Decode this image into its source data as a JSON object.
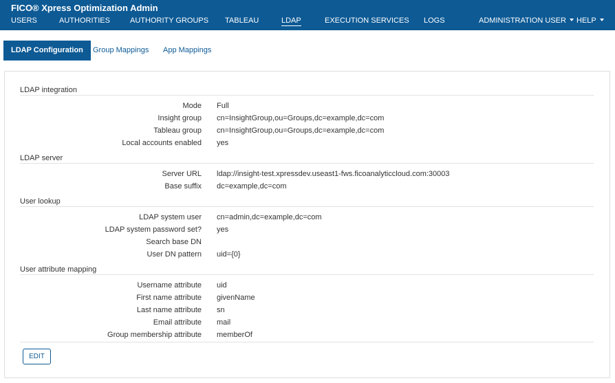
{
  "header": {
    "app_title": "FICO® Xpress Optimization Admin",
    "nav": [
      {
        "label": "USERS"
      },
      {
        "label": "AUTHORITIES"
      },
      {
        "label": "AUTHORITY GROUPS"
      },
      {
        "label": "TABLEAU"
      },
      {
        "label": "LDAP",
        "active": true
      },
      {
        "label": "EXECUTION SERVICES"
      },
      {
        "label": "LOGS"
      }
    ],
    "user_menu": "ADMINISTRATION USER",
    "help_menu": "HELP"
  },
  "subtabs": [
    {
      "label": "LDAP Configuration",
      "active": true
    },
    {
      "label": "Group Mappings"
    },
    {
      "label": "App Mappings"
    }
  ],
  "sections": [
    {
      "title": "LDAP integration",
      "rows": [
        {
          "label": "Mode",
          "value": "Full"
        },
        {
          "label": "Insight group",
          "value": "cn=InsightGroup,ou=Groups,dc=example,dc=com"
        },
        {
          "label": "Tableau group",
          "value": "cn=InsightGroup,ou=Groups,dc=example,dc=com"
        },
        {
          "label": "Local accounts enabled",
          "value": "yes"
        }
      ]
    },
    {
      "title": "LDAP server",
      "rows": [
        {
          "label": "Server URL",
          "value": "ldap://insight-test.xpressdev.useast1-fws.ficoanalyticcloud.com:30003"
        },
        {
          "label": "Base suffix",
          "value": "dc=example,dc=com"
        }
      ]
    },
    {
      "title": "User lookup",
      "rows": [
        {
          "label": "LDAP system user",
          "value": "cn=admin,dc=example,dc=com"
        },
        {
          "label": "LDAP system password set?",
          "value": "yes"
        },
        {
          "label": "Search base DN",
          "value": ""
        },
        {
          "label": "User DN pattern",
          "value": "uid={0}"
        }
      ]
    },
    {
      "title": "User attribute mapping",
      "rows": [
        {
          "label": "Username attribute",
          "value": "uid"
        },
        {
          "label": "First name attribute",
          "value": "givenName"
        },
        {
          "label": "Last name attribute",
          "value": "sn"
        },
        {
          "label": "Email attribute",
          "value": "mail"
        },
        {
          "label": "Group membership attribute",
          "value": "memberOf"
        }
      ]
    }
  ],
  "actions": {
    "edit_label": "EDIT"
  },
  "colors": {
    "brand": "#0d5a95"
  }
}
